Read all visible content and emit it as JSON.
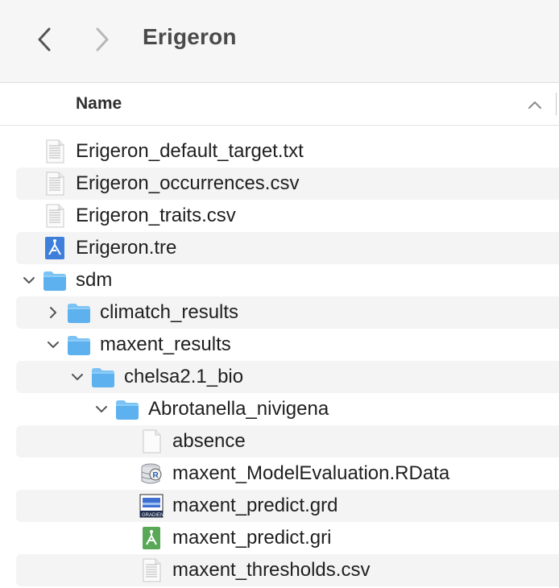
{
  "window": {
    "title": "Erigeron"
  },
  "toolbar": {
    "back_icon": "chevron-left-icon",
    "forward_icon": "chevron-right-icon"
  },
  "header": {
    "name_label": "Name",
    "sort_icon": "chevron-up-icon"
  },
  "rows": [
    {
      "label": "Erigeron_default_target.txt",
      "icon": "text-document-icon",
      "depth": 0,
      "disclosure": "none"
    },
    {
      "label": "Erigeron_occurrences.csv",
      "icon": "csv-document-icon",
      "depth": 0,
      "disclosure": "none"
    },
    {
      "label": "Erigeron_traits.csv",
      "icon": "csv-document-icon",
      "depth": 0,
      "disclosure": "none"
    },
    {
      "label": "Erigeron.tre",
      "icon": "tree-file-icon",
      "depth": 0,
      "disclosure": "none"
    },
    {
      "label": "sdm",
      "icon": "folder-icon",
      "depth": 0,
      "disclosure": "expanded"
    },
    {
      "label": "climatch_results",
      "icon": "folder-icon",
      "depth": 1,
      "disclosure": "collapsed"
    },
    {
      "label": "maxent_results",
      "icon": "folder-icon",
      "depth": 1,
      "disclosure": "expanded"
    },
    {
      "label": "chelsa2.1_bio",
      "icon": "folder-icon",
      "depth": 2,
      "disclosure": "expanded"
    },
    {
      "label": "Abrotanella_nivigena",
      "icon": "folder-icon",
      "depth": 3,
      "disclosure": "expanded"
    },
    {
      "label": "absence",
      "icon": "blank-document-icon",
      "depth": 4,
      "disclosure": "none"
    },
    {
      "label": "maxent_ModelEvaluation.RData",
      "icon": "rdata-file-icon",
      "depth": 4,
      "disclosure": "none"
    },
    {
      "label": "maxent_predict.grd",
      "icon": "gradient-file-icon",
      "depth": 4,
      "disclosure": "none"
    },
    {
      "label": "maxent_predict.gri",
      "icon": "gri-file-icon",
      "depth": 4,
      "disclosure": "none"
    },
    {
      "label": "maxent_thresholds.csv",
      "icon": "csv-document-icon",
      "depth": 4,
      "disclosure": "none"
    }
  ],
  "colors": {
    "folder": "#5cb1ee",
    "folder_tab": "#7cc3f5",
    "row_stripe": "#f4f4f4",
    "toolbar_bg": "#f6f6f6"
  }
}
